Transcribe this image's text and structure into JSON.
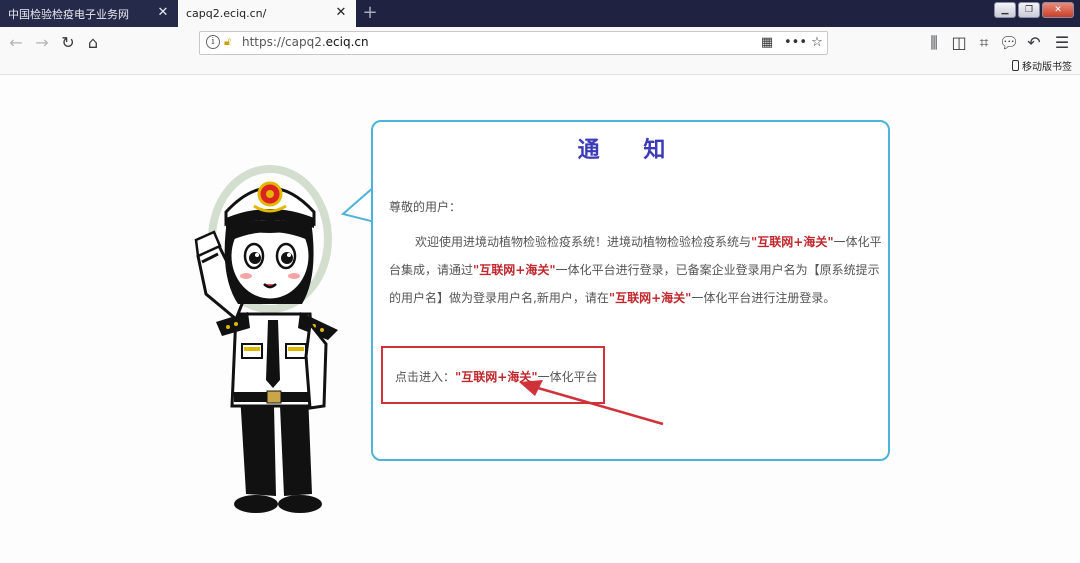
{
  "browser": {
    "tabs": [
      {
        "label": "中国检验检疫电子业务网",
        "active": false
      },
      {
        "label": "capq2.eciq.cn/",
        "active": true
      }
    ],
    "url_prefix": "https://capq2.",
    "url_domain": "eciq.cn",
    "mobile_bookmarks": "移动版书签"
  },
  "notice": {
    "title": "通 知",
    "greeting": "尊敬的用户：",
    "para_1": "欢迎使用进境动植物检验检疫系统！进境动植物检验检疫系统与",
    "hl_1": "\"互联网+海关\"",
    "para_2": "一体化平台集成，请通过",
    "hl_2": "\"互联网+海关\"",
    "para_3": "一体化平台进行登录，已备案企业登录用户名为【原系统提示的用户名】做为登录用户名,新用户，请在",
    "hl_3": "\"互联网+海关\"",
    "para_4": "一体化平台进行注册登录。",
    "entry_prefix": "点击进入：",
    "entry_link": "\"互联网+海关\"",
    "entry_suffix": "一体化平台"
  },
  "colors": {
    "bubble_border": "#4fb3d9",
    "highlight": "#c0282d",
    "title": "#3b3bb8",
    "tab_bar": "#1f2240"
  }
}
